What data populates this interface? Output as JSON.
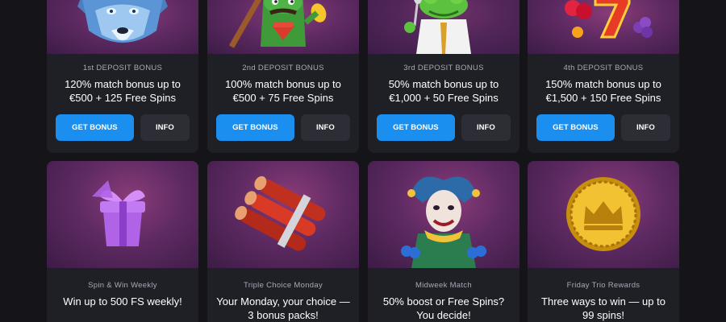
{
  "bonuses": [
    {
      "kicker": "1st DEPOSIT BONUS",
      "line1": "120% match bonus up to",
      "line2": "€500 + 125 Free Spins",
      "primary": "GET BONUS",
      "secondary": "INFO",
      "art_icon": "wolf-icon"
    },
    {
      "kicker": "2nd DEPOSIT BONUS",
      "line1": "100% match bonus up to",
      "line2": "€500 + 75 Free Spins",
      "primary": "GET BONUS",
      "secondary": "INFO",
      "art_icon": "cactus-character-icon"
    },
    {
      "kicker": "3rd DEPOSIT BONUS",
      "line1": "50% match bonus up to",
      "line2": "€1,000 + 50 Free Spins",
      "primary": "GET BONUS",
      "secondary": "INFO",
      "art_icon": "frog-singer-icon"
    },
    {
      "kicker": "4th DEPOSIT BONUS",
      "line1": "150% match bonus up to",
      "line2": "€1,500 + 150 Free Spins",
      "primary": "GET BONUS",
      "secondary": "INFO",
      "art_icon": "fruit-seven-icon"
    }
  ],
  "promotions": [
    {
      "kicker": "Spin & Win Weekly",
      "line1": "Win up to 500 FS weekly!",
      "line2": "",
      "art_icon": "gift-box-icon"
    },
    {
      "kicker": "Triple Choice Monday",
      "line1": "Your Monday, your choice —",
      "line2": "3 bonus packs!",
      "art_icon": "dynamite-icon"
    },
    {
      "kicker": "Midweek Match",
      "line1": "50% boost or Free Spins?",
      "line2": "You decide!",
      "art_icon": "jester-icon"
    },
    {
      "kicker": "Friday Trio Rewards",
      "line1": "Three ways to win — up to",
      "line2": "99 spins!",
      "art_icon": "gold-crown-coin-icon"
    }
  ],
  "colors": {
    "page_bg": "#141419",
    "card_bg": "#1f1f26",
    "primary_button": "#1a8ff0",
    "secondary_button": "#2d2d36",
    "art_bg": "#5f2a63"
  }
}
